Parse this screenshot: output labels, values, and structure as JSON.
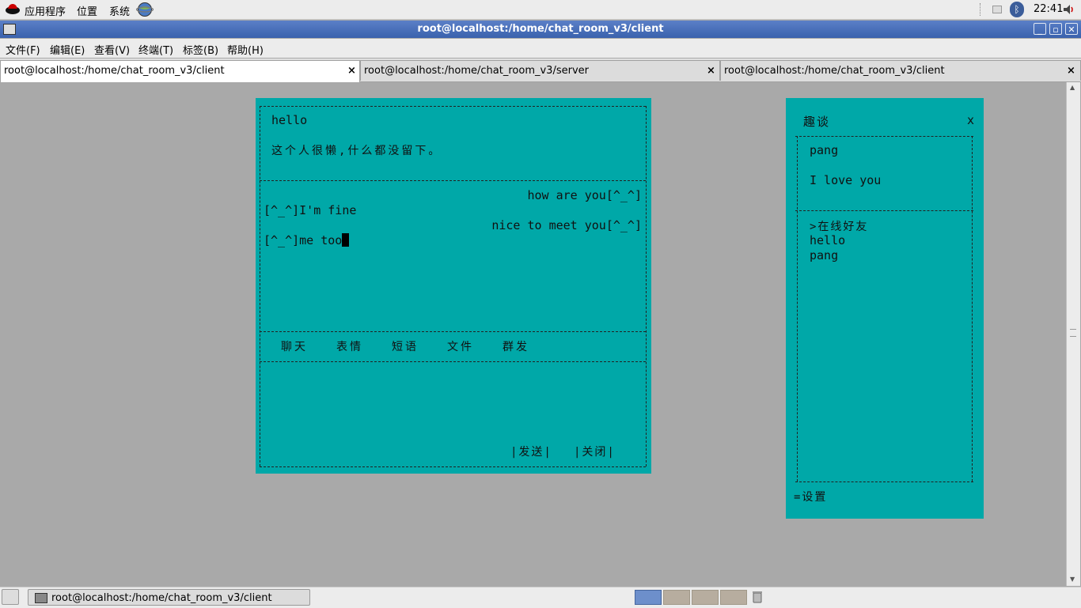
{
  "top_panel": {
    "menus": [
      "应用程序",
      "位置",
      "系统"
    ],
    "clock": "22:41"
  },
  "window": {
    "title": "root@localhost:/home/chat_room_v3/client",
    "buttons": [
      "_",
      "▫",
      "✕"
    ]
  },
  "menubar": {
    "items": [
      "文件(F)",
      "编辑(E)",
      "查看(V)",
      "终端(T)",
      "标签(B)",
      "帮助(H)"
    ]
  },
  "tabs": [
    {
      "label": "root@localhost:/home/chat_room_v3/client",
      "close": "×"
    },
    {
      "label": "root@localhost:/home/chat_room_v3/server",
      "close": "×"
    },
    {
      "label": "root@localhost:/home/chat_room_v3/client",
      "close": "×"
    }
  ],
  "chat_window": {
    "contact_name": "hello",
    "signature": "这个人很懒,什么都没留下。",
    "messages": [
      {
        "text": "how are you[^_^]",
        "side": "right"
      },
      {
        "text": "[^_^]I'm fine",
        "side": "left"
      },
      {
        "text": "nice to meet you[^_^]",
        "side": "right"
      },
      {
        "text": "[^_^]me too",
        "side": "left"
      }
    ],
    "toolbar": [
      "聊天",
      "表情",
      "短语",
      "文件",
      "群发"
    ],
    "send_label": "|发送|",
    "close_label": "|关闭|"
  },
  "friends_window": {
    "title": "趣谈",
    "close": "x",
    "user_name": "pang",
    "user_signature": "I love you",
    "online_header": ">在线好友",
    "friends": [
      "hello",
      "pang"
    ],
    "settings": "=设置"
  },
  "taskbar": {
    "task_label": "root@localhost:/home/chat_room_v3/client"
  },
  "colors": {
    "terminal_bg": "#a9a9a9",
    "panel_teal": "#00a8a8",
    "titlebar_blue": "#3a62ad"
  }
}
